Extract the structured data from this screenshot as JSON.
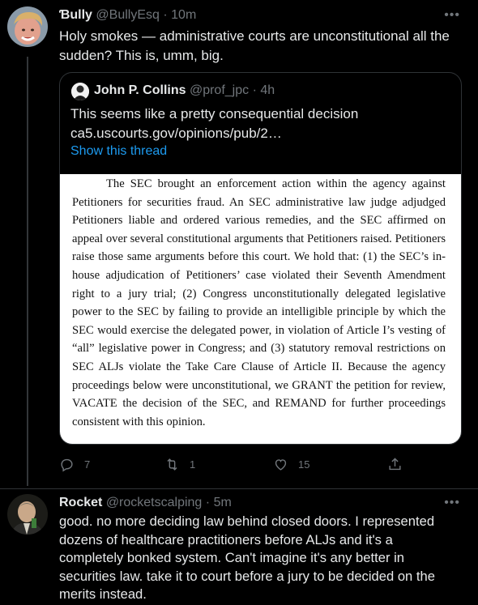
{
  "tweet1": {
    "display_name": "Ɓully",
    "handle": "@BullyEsq",
    "separator": "·",
    "time": "10m",
    "more": "•••",
    "text": "Holy smokes — administrative courts are unconstitutional all the sudden?  This is, umm, big.",
    "quote": {
      "display_name": "John P. Collins",
      "handle": "@prof_jpc",
      "separator": "·",
      "time": "4h",
      "text_line1": "This seems like a pretty consequential decision",
      "text_line2": "ca5.uscourts.gov/opinions/pub/2…",
      "show_thread": "Show this thread",
      "document_text": "The SEC brought an enforcement action within the agency against Petitioners for securities fraud.  An SEC administrative law judge adjudged Petitioners liable and ordered various remedies, and the SEC affirmed on appeal over several constitutional arguments that Petitioners raised. Petitioners raise those same arguments before this court.  We hold that: (1) the SEC’s in-house adjudication of Petitioners’ case violated their Seventh Amendment right to a jury trial; (2) Congress unconstitutionally delegated legislative power to the SEC by failing to provide an intelligible principle by which the SEC would exercise the delegated power, in violation of Article I’s vesting of “all” legislative power in Congress; and (3) statutory removal restrictions on SEC ALJs violate the Take Care Clause of Article II. Because the agency proceedings below were unconstitutional, we GRANT the petition for review, VACATE the decision of the SEC, and REMAND for further proceedings consistent with this opinion."
    },
    "actions": {
      "replies": "7",
      "retweets": "1",
      "likes": "15"
    }
  },
  "tweet2": {
    "display_name": "Rocket",
    "handle": "@rocketscalping",
    "separator": "·",
    "time": "5m",
    "more": "•••",
    "text": "good. no more deciding law behind closed doors. I represented dozens of healthcare practitioners before ALJs and it's a completely bonked system. Can't imagine it's any better in securities law. take it to court before a jury to be decided on the merits instead."
  },
  "icons": [
    "reply-icon",
    "retweet-icon",
    "like-icon",
    "share-icon",
    "more-icon"
  ],
  "colors": {
    "background": "#000000",
    "text": "#e7e9ea",
    "muted": "#71767b",
    "link": "#1d9bf0",
    "border": "#2f3336"
  }
}
